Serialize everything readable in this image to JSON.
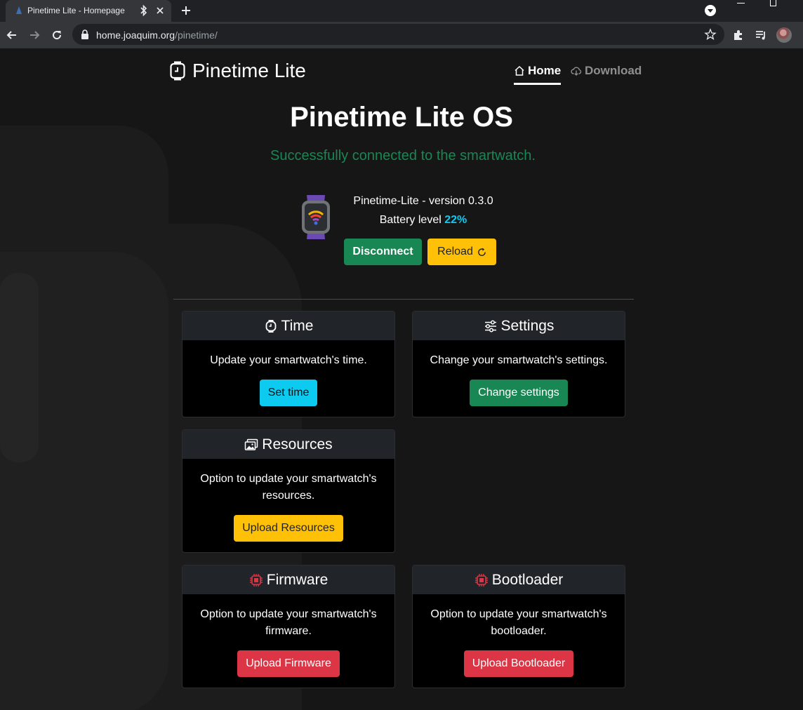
{
  "browser": {
    "tab_title": "Pinetime Lite - Homepage",
    "url_host": "home.joaquim.org",
    "url_path": "/pinetime/"
  },
  "header": {
    "brand": "Pinetime Lite",
    "nav": {
      "home": "Home",
      "download": "Download"
    }
  },
  "status": {
    "title": "Pinetime Lite OS",
    "connected_message": "Successfully connected to the smartwatch.",
    "version": "Pinetime-Lite - version 0.3.0",
    "battery_label": "Battery level",
    "battery_value": "22%",
    "disconnect_label": "Disconnect",
    "reload_label": "Reload"
  },
  "cards": {
    "time": {
      "title": "Time",
      "text": "Update your smartwatch's time.",
      "button": "Set time"
    },
    "settings": {
      "title": "Settings",
      "text": "Change your smartwatch's settings.",
      "button": "Change settings"
    },
    "resources": {
      "title": "Resources",
      "text": "Option to update your smartwatch's resources.",
      "button": "Upload Resources"
    },
    "firmware": {
      "title": "Firmware",
      "text": "Option to update your smartwatch's firmware.",
      "button": "Upload Firmware"
    },
    "bootloader": {
      "title": "Bootloader",
      "text": "Option to update your smartwatch's bootloader.",
      "button": "Upload Bootloader"
    }
  },
  "colors": {
    "success": "#198754",
    "warning": "#ffc107",
    "info": "#0dcaf0",
    "danger": "#dc3545",
    "card_header": "#212529"
  },
  "icons": {
    "brand": "watch-icon",
    "home": "house-icon",
    "download": "cloud-download-icon",
    "reload": "arrow-clockwise-icon",
    "time": "watch-icon",
    "settings": "sliders-icon",
    "resources": "images-icon",
    "firmware": "cpu-icon",
    "bootloader": "cpu-icon"
  }
}
